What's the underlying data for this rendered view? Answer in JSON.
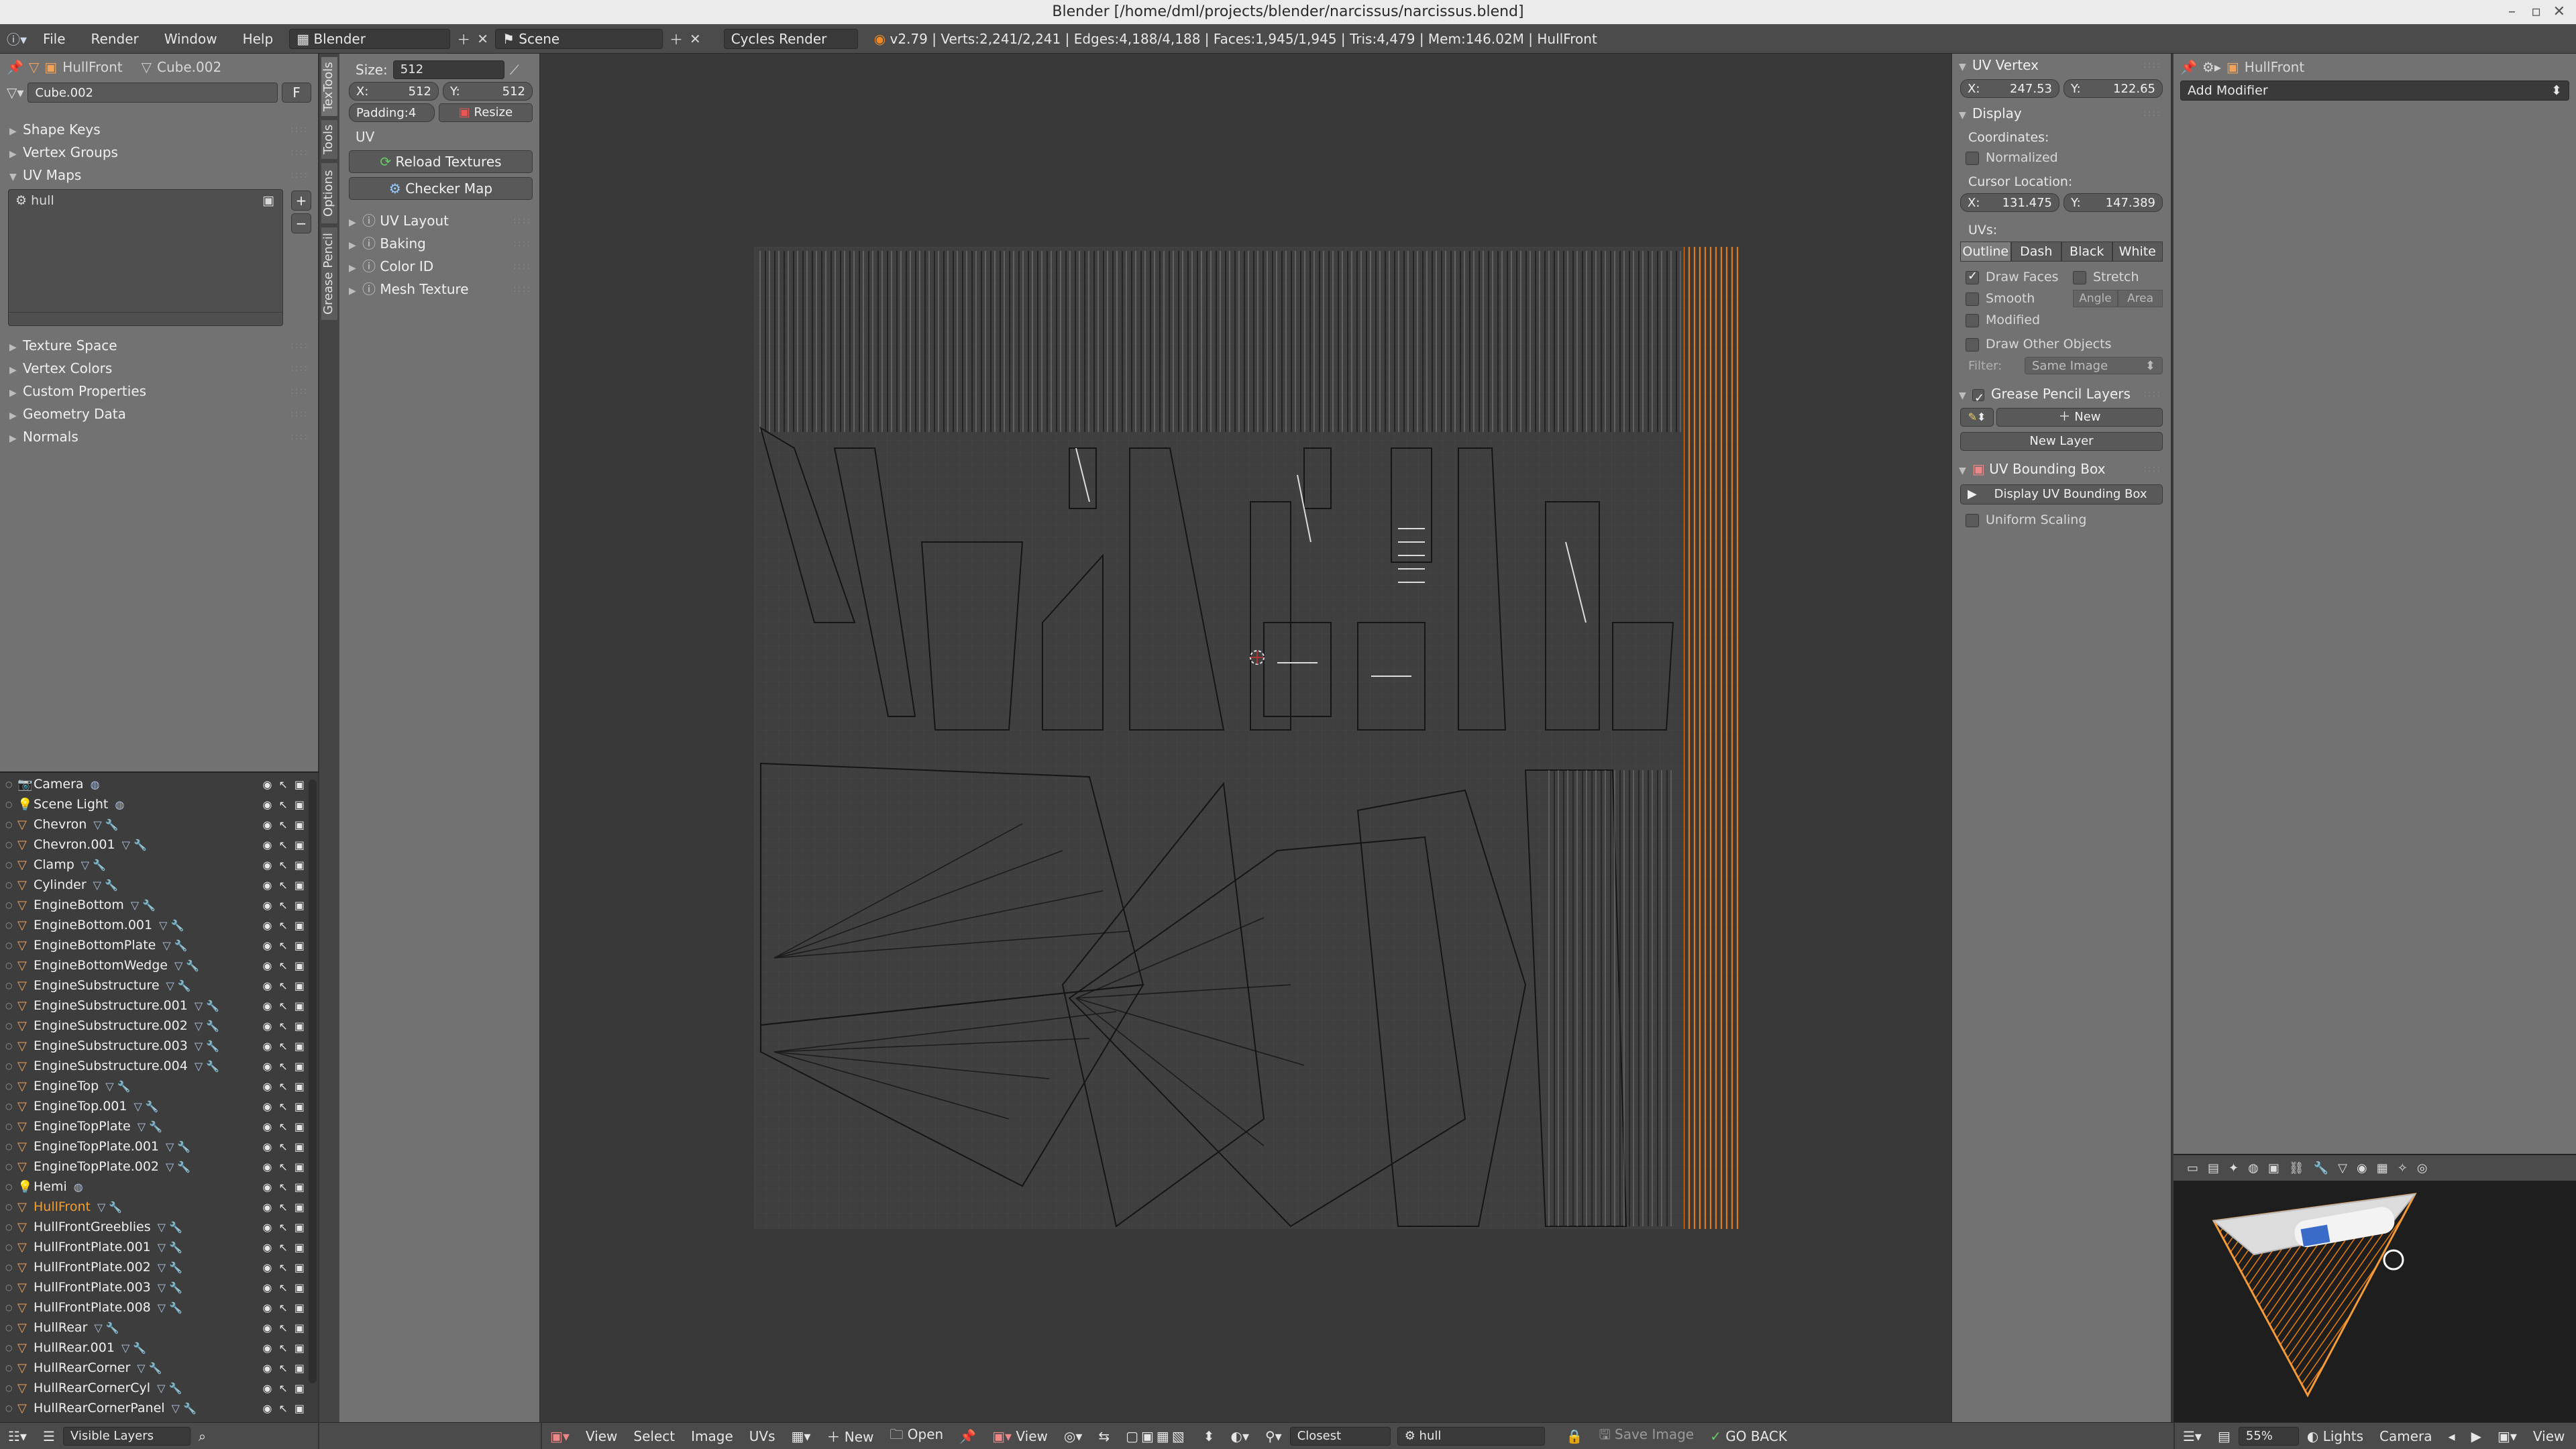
{
  "window": {
    "title": "Blender [/home/dml/projects/blender/narcissus/narcissus.blend]",
    "controls": [
      "–",
      "▫",
      "✕"
    ]
  },
  "topbar": {
    "menus": [
      "File",
      "Render",
      "Window",
      "Help"
    ],
    "screen_layout": "Blender",
    "scene": "Scene",
    "engine": "Cycles Render",
    "stats": "v2.79 | Verts:2,241/2,241 | Edges:4,188/4,188 | Faces:1,945/1,945 | Tris:4,479 | Mem:146.02M | HullFront"
  },
  "properties_left": {
    "object_name": "HullFront",
    "mesh_name": "Cube.002",
    "datablock": "Cube.002",
    "datablock_flag": "F",
    "sections": [
      "Shape Keys",
      "Vertex Groups",
      "UV Maps"
    ],
    "uv_map_item": "hull",
    "sections_after": [
      "Texture Space",
      "Vertex Colors",
      "Custom Properties",
      "Geometry Data",
      "Normals"
    ]
  },
  "toolshelf": {
    "tabs": [
      "TexTools",
      "Tools",
      "Options",
      "Grease Pencil"
    ],
    "size_label": "Size:",
    "size_value": "512",
    "x_label": "X:",
    "x_value": "512",
    "y_label": "Y:",
    "y_value": "512",
    "padding": "Padding:4",
    "resize": "Resize",
    "uv_heading": "UV",
    "reload_textures": "Reload Textures",
    "checker_map": "Checker Map",
    "subsections": [
      "UV Layout",
      "Baking",
      "Color ID",
      "Mesh Texture"
    ]
  },
  "uv_panel": {
    "vertex_heading": "UV Vertex",
    "vx_label": "X:",
    "vx_value": "247.53",
    "vy_label": "Y:",
    "vy_value": "122.65",
    "display_heading": "Display",
    "coordinates_label": "Coordinates:",
    "normalized": "Normalized",
    "cursor_label": "Cursor Location:",
    "cx_label": "X:",
    "cx_value": "131.475",
    "cy_label": "Y:",
    "cy_value": "147.389",
    "uvs_label": "UVs:",
    "uv_modes": [
      "Outline",
      "Dash",
      "Black",
      "White"
    ],
    "draw_faces": "Draw Faces",
    "stretch": "Stretch",
    "smooth": "Smooth",
    "angle": "Angle",
    "area": "Area",
    "modified": "Modified",
    "draw_other": "Draw Other Objects",
    "filter_label": "Filter:",
    "filter_value": "Same Image",
    "gp_heading": "Grease Pencil Layers",
    "gp_new": "New",
    "gp_new_layer": "New Layer",
    "bbox_heading": "UV Bounding Box",
    "bbox_display": "Display UV Bounding Box",
    "uniform_scaling": "Uniform Scaling"
  },
  "modifier_panel": {
    "object_name": "HullFront",
    "add_modifier": "Add Modifier"
  },
  "outliner": {
    "items": [
      {
        "name": "Camera",
        "icon": "camera-icon"
      },
      {
        "name": "Scene Light",
        "icon": "lamp-icon"
      },
      {
        "name": "Chevron",
        "icon": "mesh-icon"
      },
      {
        "name": "Chevron.001",
        "icon": "mesh-icon"
      },
      {
        "name": "Clamp",
        "icon": "mesh-icon"
      },
      {
        "name": "Cylinder",
        "icon": "mesh-icon"
      },
      {
        "name": "EngineBottom",
        "icon": "mesh-icon"
      },
      {
        "name": "EngineBottom.001",
        "icon": "mesh-icon"
      },
      {
        "name": "EngineBottomPlate",
        "icon": "mesh-icon"
      },
      {
        "name": "EngineBottomWedge",
        "icon": "mesh-icon"
      },
      {
        "name": "EngineSubstructure",
        "icon": "mesh-icon"
      },
      {
        "name": "EngineSubstructure.001",
        "icon": "mesh-icon"
      },
      {
        "name": "EngineSubstructure.002",
        "icon": "mesh-icon"
      },
      {
        "name": "EngineSubstructure.003",
        "icon": "mesh-icon"
      },
      {
        "name": "EngineSubstructure.004",
        "icon": "mesh-icon"
      },
      {
        "name": "EngineTop",
        "icon": "mesh-icon"
      },
      {
        "name": "EngineTop.001",
        "icon": "mesh-icon"
      },
      {
        "name": "EngineTopPlate",
        "icon": "mesh-icon"
      },
      {
        "name": "EngineTopPlate.001",
        "icon": "mesh-icon"
      },
      {
        "name": "EngineTopPlate.002",
        "icon": "mesh-icon"
      },
      {
        "name": "Hemi",
        "icon": "lamp-icon"
      },
      {
        "name": "HullFront",
        "icon": "mesh-icon"
      },
      {
        "name": "HullFrontGreeblies",
        "icon": "mesh-icon"
      },
      {
        "name": "HullFrontPlate.001",
        "icon": "mesh-icon"
      },
      {
        "name": "HullFrontPlate.002",
        "icon": "mesh-icon"
      },
      {
        "name": "HullFrontPlate.003",
        "icon": "mesh-icon"
      },
      {
        "name": "HullFrontPlate.008",
        "icon": "mesh-icon"
      },
      {
        "name": "HullRear",
        "icon": "mesh-icon"
      },
      {
        "name": "HullRear.001",
        "icon": "mesh-icon"
      },
      {
        "name": "HullRearCorner",
        "icon": "mesh-icon"
      },
      {
        "name": "HullRearCornerCyl",
        "icon": "mesh-icon"
      },
      {
        "name": "HullRearCornerPanel",
        "icon": "mesh-icon"
      }
    ],
    "footer_filter": "Visible Layers"
  },
  "image_editor_footer": {
    "menus": [
      "View",
      "Select",
      "Image",
      "UVs"
    ],
    "new": "New",
    "open": "Open",
    "view": "View",
    "snap": "Closest",
    "uvmap": "hull",
    "save_image": "Save Image",
    "go_back": "GO BACK"
  },
  "preview_footer": {
    "zoom": "55%",
    "lights": "Lights",
    "camera": "Camera",
    "view": "View"
  },
  "colors": {
    "accent_orange": "#e87d0d",
    "selected_text": "#f5a030",
    "panel_bg": "#727272",
    "editor_bg": "#393939"
  }
}
